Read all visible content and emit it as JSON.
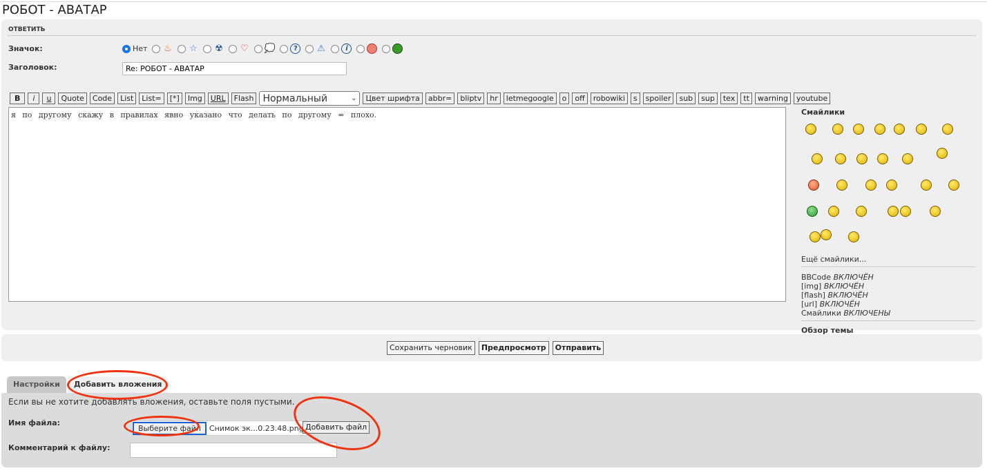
{
  "page_title": "РОБОТ - АВАТАР",
  "reply": {
    "header": "ОТВЕТИТЬ",
    "icon_label": "Значок:",
    "icon_none": "Нет",
    "icons": [
      "fire-icon",
      "star-icon",
      "radioactive-icon",
      "heart-icon",
      "thought-bubble-icon",
      "question-icon",
      "warning-icon",
      "info-icon",
      "mad-face-icon",
      "grin-face-icon"
    ],
    "subject_label": "Заголовок:",
    "subject_value": "Re: РОБОТ - АВАТАР",
    "toolbar": [
      "B",
      "i",
      "u",
      "Quote",
      "Code",
      "List",
      "List=",
      "[*]",
      "Img",
      "URL",
      "Flash"
    ],
    "font_size": "Нормальный",
    "toolbar2": [
      "Цвет шрифта",
      "abbr=",
      "bliptv",
      "hr",
      "letmegoogle",
      "o",
      "off",
      "robowiki",
      "s",
      "spoiler",
      "sub",
      "sup",
      "tex",
      "tt",
      "warning",
      "youtube"
    ],
    "message": "я по другому скажу в правилах явно указано что делать по другому = плохо."
  },
  "sidebar": {
    "smilies_title": "Смайлики",
    "more_smilies": "Ещё смайлики...",
    "status": [
      {
        "name": "BBCode",
        "value": "ВКЛЮЧЁН"
      },
      {
        "name": "[img]",
        "value": "ВКЛЮЧЁН"
      },
      {
        "name": "[flash]",
        "value": "ВКЛЮЧЁН"
      },
      {
        "name": "[url]",
        "value": "ВКЛЮЧЁН"
      },
      {
        "name": "Смайлики",
        "value": "ВКЛЮЧЕНЫ"
      }
    ],
    "topic_review": "Обзор темы"
  },
  "actions": {
    "save_draft": "Сохранить черновик",
    "preview": "Предпросмотр",
    "submit": "Отправить"
  },
  "tabs": {
    "settings": "Настройки",
    "attachments": "Добавить вложения"
  },
  "attachments": {
    "hint": "Если вы не хотите добавлять вложения, оставьте поля пустыми.",
    "filename_label": "Имя файла:",
    "choose_file": "Выберите файл",
    "chosen_file": "Снимок эк...0.23.48.png",
    "add_file": "Добавить файл",
    "comment_label": "Комментарий к файлу:"
  },
  "colors": {
    "annotation": "#f0320e",
    "panel": "#efefef"
  }
}
